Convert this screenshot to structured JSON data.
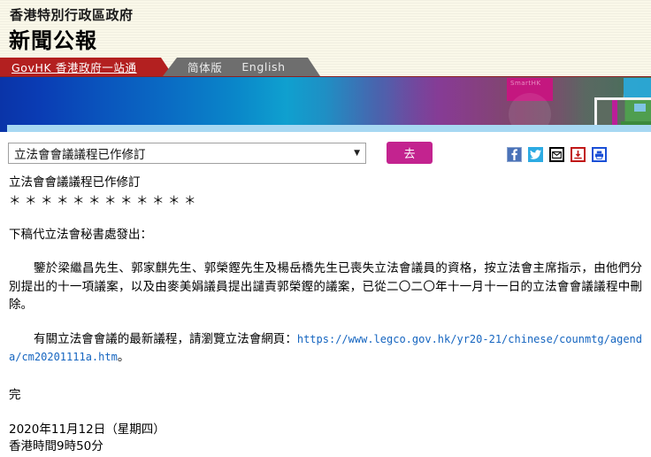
{
  "header": {
    "organization": "香港特別行政區政府",
    "title": "新聞公報",
    "tabs": [
      {
        "id": "govhk",
        "label": "GovHK 香港政府一站通"
      },
      {
        "id": "simplified",
        "label": "简体版"
      },
      {
        "id": "english",
        "label": "English"
      }
    ]
  },
  "banner": {
    "watermark": "SmartHK",
    "colors": {
      "blue": "#0a34a8",
      "cyan": "#0fa0cf",
      "purple": "#6b4fa4",
      "magenta": "#c4177f",
      "green": "#4ca44c",
      "bottom_strip": "#a7d8f2"
    }
  },
  "controls": {
    "select": {
      "value": "立法會會議議程已作修訂",
      "caret": "▼"
    },
    "go_label": "去",
    "go_color": "#c3238f",
    "social_icons": [
      {
        "name": "facebook-icon",
        "glyph": "f"
      },
      {
        "name": "twitter-icon",
        "glyph": "ᴠ"
      },
      {
        "name": "email-icon",
        "glyph": "✉"
      },
      {
        "name": "download-icon",
        "glyph": "⬇"
      },
      {
        "name": "print-icon",
        "glyph": "⎙"
      }
    ]
  },
  "article": {
    "headline": "立法會會議議程已作修訂",
    "separator": "＊＊＊＊＊＊＊＊＊＊＊＊",
    "issuer": "下稿代立法會秘書處發出：",
    "paragraph1": "鑒於梁繼昌先生、郭家麒先生、郭榮鏗先生及楊岳橋先生已喪失立法會議員的資格，按立法會主席指示，由他們分別提出的十一項議案，以及由麥美娟議員提出譴責郭榮鏗的議案，已從二〇二〇年十一月十一日的立法會會議議程中刪除。",
    "paragraph2_prefix": "有關立法會會議的最新議程，請瀏覽立法會網頁：",
    "link_text": "https://www.legco.gov.hk/yr20-21/chinese/counmtg/agenda/cm20201111a.htm",
    "paragraph2_suffix": "。",
    "end_marker": "完",
    "date_line": "2020年11月12日（星期四）",
    "time_line": "香港時間9時50分"
  }
}
